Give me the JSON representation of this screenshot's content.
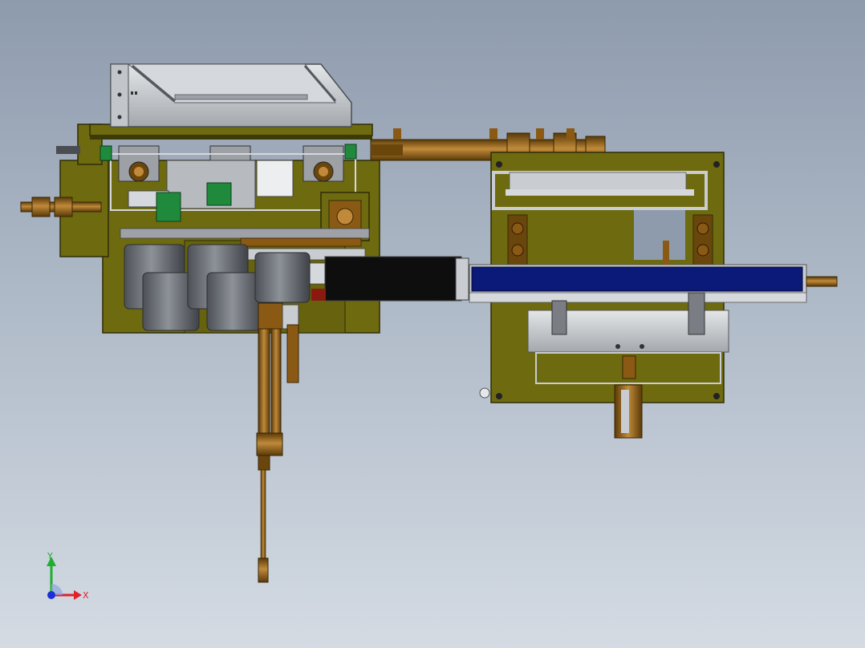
{
  "triad": {
    "x_label": "X",
    "y_label": "Y",
    "x_color": "#e0202a",
    "y_color": "#1fae2f",
    "z_color": "#1a2fd6"
  },
  "palette": {
    "olive": "#6e6a10",
    "olive_dark": "#3c3a06",
    "brass": "#8a5a14",
    "brass_light": "#c08a3a",
    "steel": "#c9ccd0",
    "steel_dark": "#7a7e84",
    "cylinder": "#6d7178",
    "belt": "#0b1a78",
    "green_part": "#1f8a3c"
  }
}
